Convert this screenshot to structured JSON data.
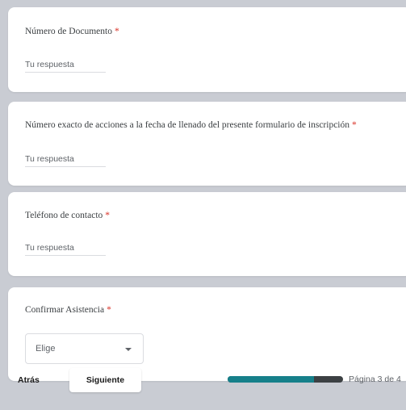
{
  "questions": [
    {
      "title": "Número de Documento",
      "required": "*",
      "placeholder": "Tu respuesta"
    },
    {
      "title": "Número exacto de acciones a la fecha de llenado del presente formulario de inscripción",
      "required": "*",
      "placeholder": "Tu respuesta"
    },
    {
      "title": "Teléfono de contacto",
      "required": "*",
      "placeholder": "Tu respuesta"
    },
    {
      "title": "Confirmar Asistencia",
      "required": "*",
      "select_value": "Elige"
    }
  ],
  "navigation": {
    "back_label": "Atrás",
    "next_label": "Siguiente",
    "page_text": "Página 3 de 4",
    "progress_fraction": 0.75
  },
  "colors": {
    "background": "#c9ccd3",
    "progress_fill": "#16808a",
    "progress_track": "#3c4043",
    "required_mark": "#d93025"
  },
  "icons": {
    "select_arrow": "caret-down-icon"
  }
}
